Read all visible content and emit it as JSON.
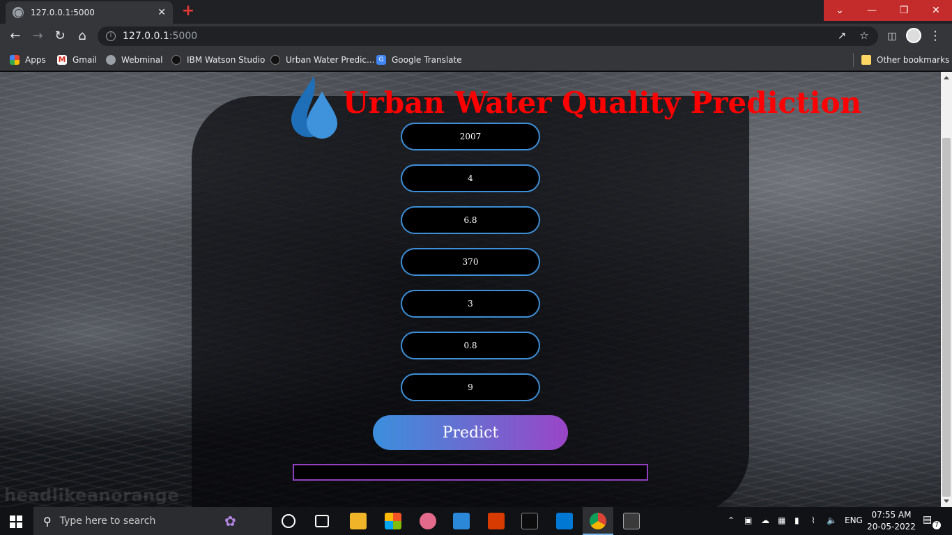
{
  "browser": {
    "tab_title": "127.0.0.1:5000",
    "tab_close": "✕",
    "new_tab": "+",
    "url_host": "127.0.0.1",
    "url_port": ":5000",
    "window_controls": [
      "⌄",
      "—",
      "❐",
      "✕"
    ],
    "bookmarks": [
      {
        "label": "Apps",
        "icon": "apps-grid-icon",
        "color": "#ea4335"
      },
      {
        "label": "Gmail",
        "icon": "gmail-icon",
        "color": "#d93025"
      },
      {
        "label": "Webminal",
        "icon": "globe-icon",
        "color": "#9aa0a6"
      },
      {
        "label": "IBM Watson Studio",
        "icon": "bug-icon",
        "color": "#3c4043"
      },
      {
        "label": "Urban Water Predic...",
        "icon": "bug-icon",
        "color": "#3c4043"
      },
      {
        "label": "Google Translate",
        "icon": "translate-icon",
        "color": "#4285f4"
      }
    ],
    "other_bookmarks": "Other bookmarks"
  },
  "page": {
    "title": "Urban Water Quality Prediction",
    "watermark": "headlikeanorange",
    "fields": [
      "2007",
      "4",
      "6.8",
      "370",
      "3",
      "0.8",
      "9"
    ],
    "predict_label": "Predict",
    "result_text": "",
    "colors": {
      "title": "#ff0000",
      "field_border": "#3d8fd8",
      "result_border": "#8f3fbf"
    }
  },
  "taskbar": {
    "search_placeholder": "Type here to search",
    "language": "ENG",
    "time": "07:55 AM",
    "date": "20-05-2022",
    "notification_count": "7"
  }
}
